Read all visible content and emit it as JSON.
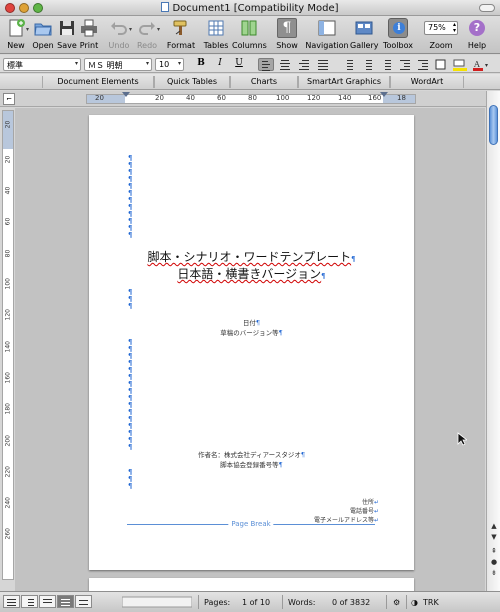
{
  "window": {
    "title": "Document1 [Compatibility Mode]"
  },
  "toolbar": {
    "items": [
      {
        "label": "New"
      },
      {
        "label": "Open"
      },
      {
        "label": "Save"
      },
      {
        "label": "Print"
      },
      {
        "label": "Undo"
      },
      {
        "label": "Redo"
      },
      {
        "label": "Format"
      },
      {
        "label": "Tables"
      },
      {
        "label": "Columns"
      },
      {
        "label": "Show"
      },
      {
        "label": "Navigation"
      },
      {
        "label": "Gallery"
      },
      {
        "label": "Toolbox"
      },
      {
        "label": "Zoom"
      },
      {
        "label": "Help"
      }
    ],
    "zoom_value": "75%"
  },
  "formatting": {
    "style": "標準",
    "font": "ＭＳ 明朝",
    "size": "10",
    "bold": "B",
    "italic": "I",
    "underline": "U"
  },
  "gallery_tabs": [
    {
      "label": "Document Elements"
    },
    {
      "label": "Quick Tables"
    },
    {
      "label": "Charts"
    },
    {
      "label": "SmartArt Graphics"
    },
    {
      "label": "WordArt"
    }
  ],
  "ruler": {
    "horizontal_ticks": [
      "20",
      "20",
      "40",
      "60",
      "80",
      "100",
      "120",
      "140",
      "160",
      "18"
    ],
    "vertical_ticks": [
      "20",
      "20",
      "40",
      "60",
      "80",
      "100",
      "120",
      "140",
      "160",
      "180",
      "200",
      "220",
      "240",
      "260"
    ]
  },
  "document": {
    "title_line_1": "脚本・シナリオ・ワードテンプレート",
    "title_line_2": "日本語・横書きバージョン",
    "date_line": "日付",
    "draft_line": "草稿のバージョン等",
    "author_line": "作者名：株式会社ディアースタジオ",
    "registration_line": "脚本協会登録番号等",
    "address_lines": [
      "住所",
      "電話番号",
      "電子メールアドレス等"
    ],
    "pilcrow": "¶",
    "page_break": "Page Break"
  },
  "statusbar": {
    "pages_label": "Pages:",
    "pages_value": "1 of 10",
    "words_label": "Words:",
    "words_value": "0 of 3832",
    "trk": "TRK"
  },
  "colors": {
    "paragraph_mark": "#1f66d3",
    "accent": "#5d93d9",
    "spelling_underline": "#d00000"
  }
}
